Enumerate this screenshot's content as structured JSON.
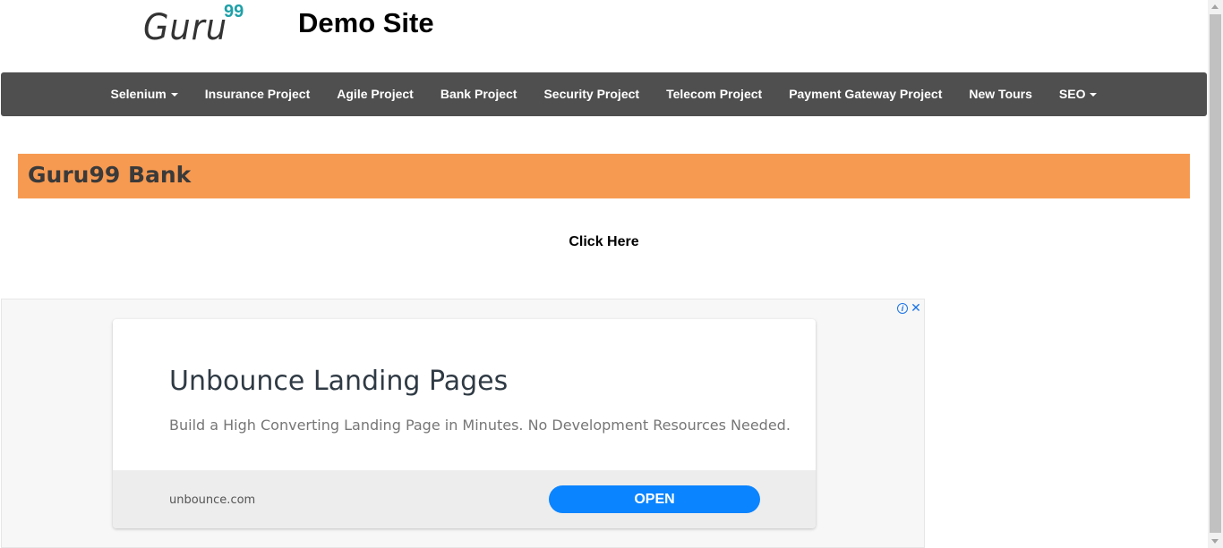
{
  "header": {
    "logo_word": "Guru",
    "logo_number": "99",
    "site_title": "Demo Site"
  },
  "nav": {
    "items": [
      {
        "label": "Selenium",
        "dropdown": true
      },
      {
        "label": "Insurance Project",
        "dropdown": false
      },
      {
        "label": "Agile Project",
        "dropdown": false
      },
      {
        "label": "Bank Project",
        "dropdown": false
      },
      {
        "label": "Security Project",
        "dropdown": false
      },
      {
        "label": "Telecom Project",
        "dropdown": false
      },
      {
        "label": "Payment Gateway Project",
        "dropdown": false
      },
      {
        "label": "New Tours",
        "dropdown": false
      },
      {
        "label": "SEO",
        "dropdown": true
      }
    ]
  },
  "banner": {
    "title": "Guru99 Bank"
  },
  "main": {
    "link_label": "Click Here"
  },
  "ad": {
    "headline": "Unbounce Landing Pages",
    "description": "Build a High Converting Landing Page in Minutes. No Development Resources Needed.",
    "domain": "unbounce.com",
    "cta_label": "OPEN",
    "info_icon": "info-icon",
    "close_icon": "close-icon"
  },
  "colors": {
    "navbar": "#4f4f4f",
    "banner": "#f79a51",
    "logo_accent": "#1fa0a8",
    "cta": "#0a84ff"
  }
}
